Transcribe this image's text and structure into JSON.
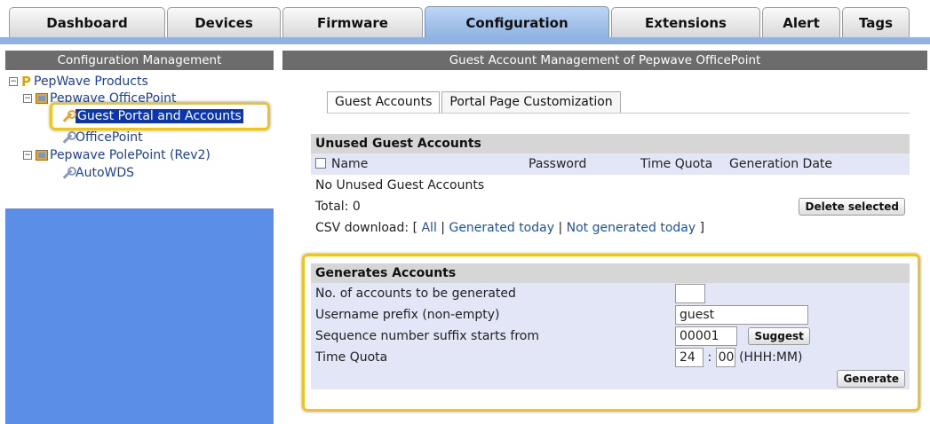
{
  "tabs": [
    {
      "label": "Dashboard"
    },
    {
      "label": "Devices"
    },
    {
      "label": "Firmware"
    },
    {
      "label": "Configuration"
    },
    {
      "label": "Extensions"
    },
    {
      "label": "Alert"
    },
    {
      "label": "Tags"
    }
  ],
  "sidebar": {
    "title": "Configuration Management",
    "tree": {
      "root": "PepWave Products",
      "node1": "Pepwave OfficePoint",
      "node1_child_selected": "Guest Portal and Accounts",
      "node1_child2": "OfficePoint",
      "node2": "Pepwave PolePoint (Rev2)",
      "node2_child": "AutoWDS"
    }
  },
  "main": {
    "title": "Guest Account Management of Pepwave OfficePoint",
    "subtabs": [
      "Guest Accounts",
      "Portal Page Customization"
    ],
    "unused": {
      "title": "Unused Guest Accounts",
      "columns": [
        "Name",
        "Password",
        "Time Quota",
        "Generation Date"
      ],
      "empty_text": "No Unused Guest Accounts",
      "total": "Total: 0",
      "delete_label": "Delete selected",
      "csv_label": "CSV download:",
      "csv_open": "[",
      "csv_all": "All",
      "csv_sep": "|",
      "csv_today": "Generated today",
      "csv_not_today": "Not generated today",
      "csv_close": "]"
    },
    "generate": {
      "title": "Generates Accounts",
      "count_label": "No. of accounts to be generated",
      "count_value": "",
      "prefix_label": "Username prefix (non-empty)",
      "prefix_value": "guest",
      "suffix_label": "Sequence number suffix starts from",
      "suffix_value": "00001",
      "suggest_label": "Suggest",
      "quota_label": "Time Quota",
      "quota_hours": "24",
      "quota_colon": ":",
      "quota_minutes": "00",
      "quota_unit": "(HHH:MM)",
      "generate_label": "Generate"
    }
  },
  "colors": {
    "highlight": "#f0c419",
    "tab_active": "#8fb3e2",
    "sidebar_bg": "#5b8ee6",
    "selected": "#0a36b5"
  }
}
